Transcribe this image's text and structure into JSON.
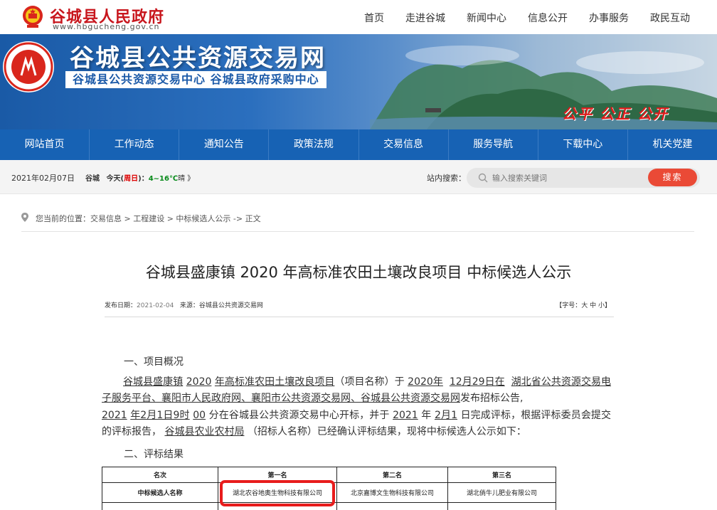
{
  "header": {
    "gov_title": "谷城县人民政府",
    "gov_url": "www.hbgucheng.gov.cn",
    "nav": [
      "首页",
      "走进谷城",
      "新闻中心",
      "信息公开",
      "办事服务",
      "政民互动"
    ]
  },
  "banner": {
    "title": "谷城县公共资源交易网",
    "subtitle": "谷城县公共资源交易中心 谷城县政府采购中心",
    "slogan": "公平 公正 公开"
  },
  "mainnav": [
    "网站首页",
    "工作动态",
    "通知公告",
    "政策法规",
    "交易信息",
    "服务导航",
    "下载中心",
    "机关党建"
  ],
  "infobar": {
    "date": "2021年02月07日",
    "weather_city": "谷城",
    "weather_today": "今天(",
    "weather_weekday": "周日",
    "weather_close": ")：",
    "weather_temp": "4~16℃",
    "weather_cond": "晴 》",
    "search_label": "站内搜索：",
    "search_placeholder": "输入搜索关键词",
    "search_button": "搜索"
  },
  "breadcrumb": "您当前的位置：交易信息 > 工程建设 > 中标候选人公示 -> 正文",
  "article": {
    "title": "谷城县盛康镇 2020 年高标准农田土壤改良项目 中标候选人公示",
    "publish_label": "发布日期：",
    "publish_date": "2021-02-04",
    "source_label": "来源：谷城县公共资源交易网",
    "font_size_ctrl": "【字号：大 中 小】",
    "section1": "一、项目概况",
    "section2": "二、评标结果",
    "para": {
      "p1": "谷城县盛康镇",
      "p2": "2020",
      "p3": "年高标准农田土壤改良项目",
      "p4": "（项目名称）于",
      "p5": "2020年",
      "p6": "12月29日在",
      "p7": "湖北省公共资源交易电子服务平台、襄阳市人民政府网、襄阳市公共资源交易网、谷城县公共资源交易网",
      "p8": "发布招标公告,",
      "p9": "2021",
      "p10": "年2月1日9时",
      "p11": "00",
      "p12": "分在谷城县公共资源交易中心开标，并于",
      "p13": "2021",
      "p14": "年",
      "p15": "2月",
      "p16": "1",
      "p17": "日完成评标，根据评标委员会提交的评标报告，",
      "p18": "谷城县农业农村局",
      "p19": "（招标人名称）已经确认评标结果，现将中标候选人公示如下："
    }
  },
  "table": {
    "headers": [
      "名次",
      "第一名",
      "第二名",
      "第三名"
    ],
    "row_label": "中标候选人名称",
    "candidates": [
      "湖北农谷地奥生物科技有限公司",
      "北京嘉博文生物科技有限公司",
      "湖北倘牛儿肥业有限公司"
    ]
  }
}
